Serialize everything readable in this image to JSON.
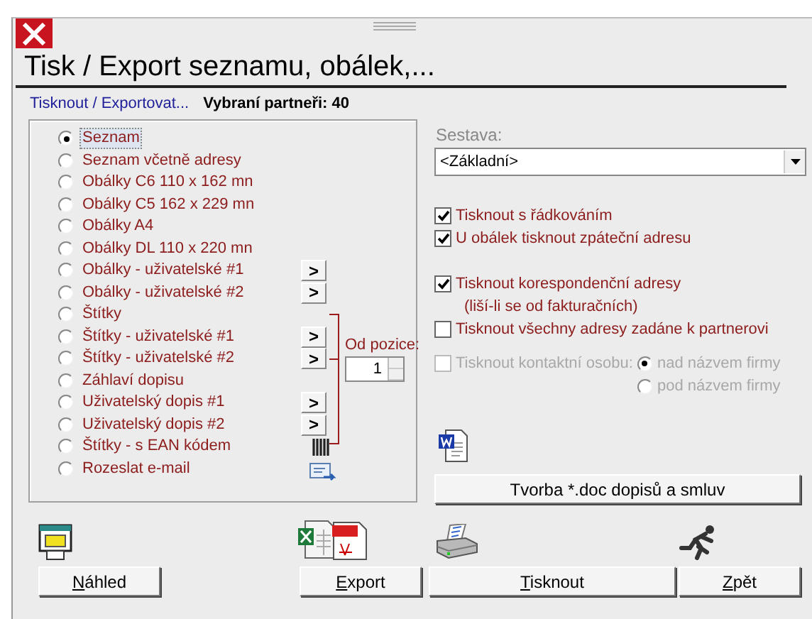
{
  "window": {
    "title": "Tisk / Export seznamu, obálek,..."
  },
  "subtitle": {
    "link": "Tisknout / Exportovat...",
    "selection": "Vybraní partneři: 40"
  },
  "options": [
    {
      "label": "Seznam",
      "selected": true,
      "kind": "plain"
    },
    {
      "label": "Seznam včetně adresy",
      "selected": false,
      "kind": "plain"
    },
    {
      "label": "Obálky C6 110 x 162 mn",
      "selected": false,
      "kind": "plain"
    },
    {
      "label": "Obálky C5 162 x 229 mn",
      "selected": false,
      "kind": "plain"
    },
    {
      "label": "Obálky A4",
      "selected": false,
      "kind": "plain"
    },
    {
      "label": "Obálky DL 110 x 220 mn",
      "selected": false,
      "kind": "plain"
    },
    {
      "label": "Obálky - uživatelské #1",
      "selected": false,
      "kind": "button",
      "button": ">"
    },
    {
      "label": "Obálky - uživatelské #2",
      "selected": false,
      "kind": "button",
      "button": ">"
    },
    {
      "label": "Štítky",
      "selected": false,
      "kind": "plain"
    },
    {
      "label": "Štítky - uživatelské #1",
      "selected": false,
      "kind": "button",
      "button": ">"
    },
    {
      "label": "Štítky - uživatelské #2",
      "selected": false,
      "kind": "button",
      "button": ">"
    },
    {
      "label": "Záhlaví dopisu",
      "selected": false,
      "kind": "plain"
    },
    {
      "label": "Uživatelský dopis #1",
      "selected": false,
      "kind": "button",
      "button": ">"
    },
    {
      "label": "Uživatelský dopis #2",
      "selected": false,
      "kind": "button",
      "button": ">"
    },
    {
      "label": "Štítky - s EAN kódem",
      "selected": false,
      "kind": "barcode"
    },
    {
      "label": "Rozeslat e-mail",
      "selected": false,
      "kind": "mail"
    }
  ],
  "start_position": {
    "label": "Od pozice:",
    "value": "1"
  },
  "report": {
    "label": "Sestava:",
    "value": "<Základní>"
  },
  "checks": [
    {
      "label": "Tisknout s řádkováním",
      "checked": true,
      "disabled": false
    },
    {
      "label": "U obálek tisknout zpáteční adresu",
      "checked": true,
      "disabled": false
    },
    {
      "label": "Tisknout korespondenční adresy",
      "note": "(liší-li se od fakturačních)",
      "checked": true,
      "disabled": false
    },
    {
      "label": "Tisknout všechny adresy zadáne k partnerovi",
      "checked": false,
      "disabled": false
    },
    {
      "label": "Tisknout kontaktní osobu:",
      "checked": false,
      "disabled": true
    }
  ],
  "contact_position": [
    {
      "label": "nad názvem firmy",
      "selected": true,
      "disabled": true
    },
    {
      "label": "pod názvem firmy",
      "selected": false,
      "disabled": true
    }
  ],
  "doc_button": "Tvorba *.doc dopisů a smluv",
  "buttons": [
    {
      "key": "N",
      "rest": "áhled",
      "kind": "preview"
    },
    {
      "key": "E",
      "rest": "xport",
      "kind": "export"
    },
    {
      "key": "T",
      "rest": "isknout",
      "kind": "print"
    },
    {
      "key": "Z",
      "rest": "pět",
      "kind": "back"
    }
  ]
}
